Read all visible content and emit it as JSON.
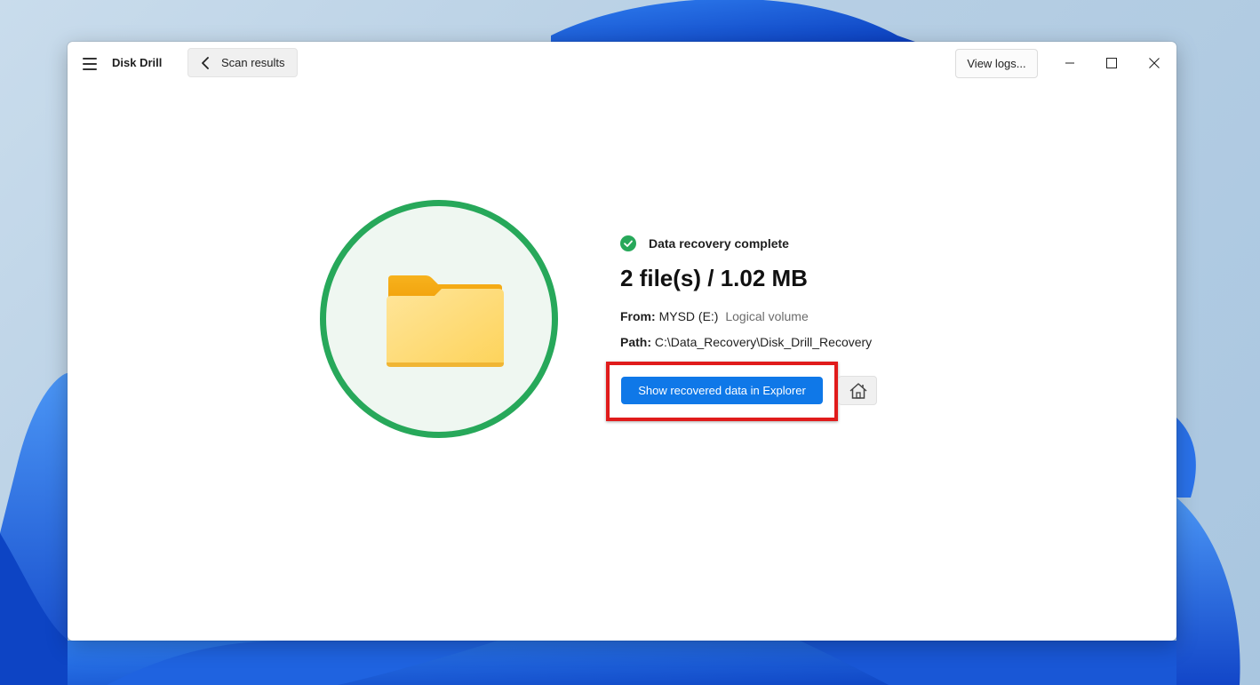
{
  "app": {
    "title": "Disk Drill"
  },
  "toolbar": {
    "back_label": "Scan results",
    "view_logs_label": "View logs..."
  },
  "result": {
    "status": "Data recovery complete",
    "summary": "2 file(s) / 1.02 MB",
    "from_key": "From:",
    "from_value": "MYSD (E:)",
    "from_type": "Logical volume",
    "path_key": "Path:",
    "path_value": "C:\\Data_Recovery\\Disk_Drill_Recovery",
    "primary_action_label": "Show recovered data in Explorer"
  },
  "icons": {
    "menu": "hamburger-menu-icon",
    "back": "chevron-left-icon",
    "minimize": "minimize-icon",
    "maximize": "maximize-icon",
    "close": "close-icon",
    "folder": "folder-icon",
    "success": "check-circle-icon",
    "home": "home-icon"
  },
  "colors": {
    "success_green": "#27a85a",
    "primary_blue": "#0f78e8",
    "highlight_red": "#e01b1b",
    "folder_yellow": "#fbc02d"
  }
}
